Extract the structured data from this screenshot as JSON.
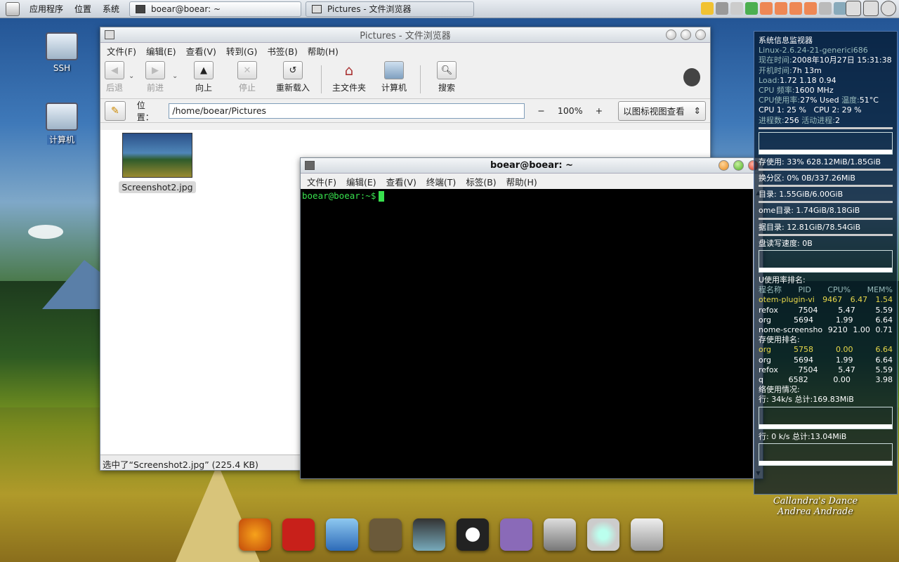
{
  "top_panel": {
    "menus": [
      "应用程序",
      "位置",
      "系统"
    ],
    "tasks": [
      {
        "label": "boear@boear: ~",
        "active": true
      },
      {
        "label": "Pictures - 文件浏览器",
        "active": false
      }
    ]
  },
  "desktop": {
    "icons": [
      {
        "label": "SSH"
      },
      {
        "label": "计算机"
      }
    ]
  },
  "file_browser": {
    "title": "Pictures - 文件浏览器",
    "menu": [
      "文件(F)",
      "编辑(E)",
      "查看(V)",
      "转到(G)",
      "书签(B)",
      "帮助(H)"
    ],
    "toolbar": {
      "back": "后退",
      "forward": "前进",
      "up": "向上",
      "stop": "停止",
      "reload": "重新载入",
      "home": "主文件夹",
      "computer": "计算机",
      "search": "搜索"
    },
    "location_label": "位置：",
    "location_value": "/home/boear/Pictures",
    "zoom_minus": "−",
    "zoom_level": "100%",
    "zoom_plus": "+",
    "view_mode": "以图标视图查看",
    "files": [
      {
        "name": "Screenshot2.jpg"
      }
    ],
    "status": "选中了“Screenshot2.jpg” (225.4 KB)"
  },
  "terminal": {
    "title": "boear@boear: ~",
    "menu": [
      "文件(F)",
      "编辑(E)",
      "查看(V)",
      "终端(T)",
      "标签(B)",
      "帮助(H)"
    ],
    "prompt": "boear@boear:~$"
  },
  "conky": {
    "title": "系统信息监视器",
    "kernel": "Linux-2.6.24-21-generici686",
    "time_label": "现在时间:",
    "time_value": "2008年10月27日 15:31:38",
    "uptime_label": "开机时间:",
    "uptime_value": "7h 13m",
    "load_label": "Load:",
    "load_value": "1.72 1.18 0.94",
    "cpu_freq_label": "CPU 频率:",
    "cpu_freq_value": "1600 MHz",
    "cpu_usage_label": "CPU使用率:",
    "cpu_usage_value": "27% Used",
    "temp_label": "温度:",
    "temp_value": "51°C",
    "cpu1": "CPU 1: 25 %",
    "cpu2": "CPU 2: 29 %",
    "procs_label": "进程数:",
    "procs_value": "256",
    "running_label": "活动进程:",
    "running_value": "2",
    "mem": "存使用: 33% 628.12MiB/1.85GiB",
    "swap": "换分区: 0% 0B/337.26MiB",
    "root": "目录: 1.55GiB/6.00GiB",
    "home": "ome目录: 1.74GiB/8.18GiB",
    "data": "据目录: 12.81GiB/78.54GiB",
    "disk_io": "盘读写速度: 0B",
    "cpu_rank_title": "U使用率排名:",
    "cpu_rank_header": [
      "程名称",
      "PID",
      "CPU%",
      "MEM%"
    ],
    "cpu_rank": [
      [
        "otem-plugin-vi",
        "9467",
        "6.47",
        "1.54"
      ],
      [
        "refox",
        "7504",
        "5.47",
        "5.59"
      ],
      [
        "org",
        "5694",
        "1.99",
        "6.64"
      ],
      [
        "nome-screensho",
        "9210",
        "1.00",
        "0.71"
      ]
    ],
    "mem_rank_title": "存使用排名:",
    "mem_rank": [
      [
        "org",
        "5758",
        "0.00",
        "6.64"
      ],
      [
        "org",
        "5694",
        "1.99",
        "6.64"
      ],
      [
        "refox",
        "7504",
        "5.47",
        "5.59"
      ],
      [
        "q",
        "6582",
        "0.00",
        "3.98"
      ]
    ],
    "net_title": "络使用情况:",
    "net_down": "行: 34k/s 总计:169.83MiB",
    "net_up": "行: 0 k/s 总计:13.04MiB"
  },
  "wallpaper_credit": {
    "line1": "Callandra's Dance",
    "line2": "Andrea Andrade"
  },
  "dock": [
    "firefox-icon",
    "filezilla-icon",
    "network-icon",
    "gimp-icon",
    "video-editor-icon",
    "qq-penguin-icon",
    "pidgin-icon",
    "terminal-icon",
    "music-player-icon",
    "hard-drive-icon"
  ],
  "colors": {
    "terminal_fg": "#38e04e",
    "terminal_bg": "#000000",
    "selection": "#3b6fb0"
  }
}
